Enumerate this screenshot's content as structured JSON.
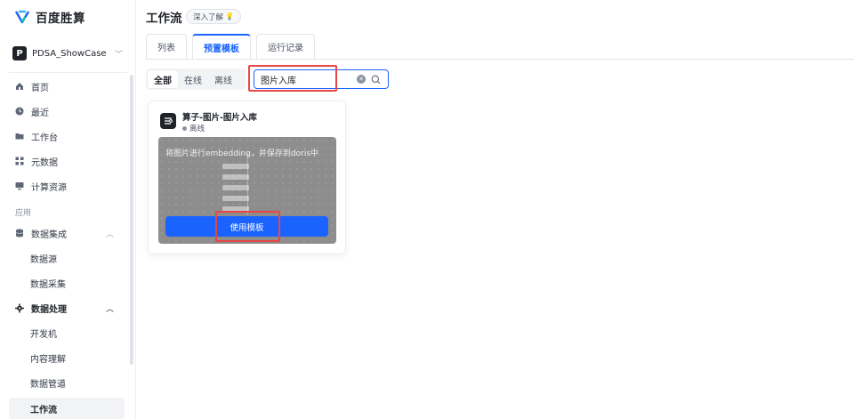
{
  "app": {
    "name": "百度胜算"
  },
  "workspace": {
    "avatar_letter": "P",
    "name": "PDSA_ShowCase"
  },
  "sidebar": {
    "items": [
      {
        "label": "首页",
        "icon": "home-icon"
      },
      {
        "label": "最近",
        "icon": "clock-icon"
      },
      {
        "label": "工作台",
        "icon": "folder-icon"
      },
      {
        "label": "元数据",
        "icon": "grid-icon"
      },
      {
        "label": "计算资源",
        "icon": "monitor-icon"
      }
    ],
    "section_label": "应用",
    "groups": [
      {
        "label": "数据集成",
        "icon": "database-icon",
        "children": [
          "数据源",
          "数据采集"
        ]
      },
      {
        "label": "数据处理",
        "icon": "gear-icon",
        "children": [
          "开发机",
          "内容理解",
          "数据管道",
          "工作流"
        ]
      }
    ]
  },
  "header": {
    "title": "工作流",
    "learn_more": "深入了解"
  },
  "tabs": [
    {
      "label": "列表"
    },
    {
      "label": "预置模板",
      "active": true
    },
    {
      "label": "运行记录"
    }
  ],
  "filters": [
    {
      "label": "全部",
      "active": true
    },
    {
      "label": "在线"
    },
    {
      "label": "离线"
    }
  ],
  "search": {
    "value": "图片入库"
  },
  "template_card": {
    "title": "算子-图片-图片入库",
    "status": "离线",
    "description": "将图片进行embedding，并保存到doris中",
    "button_label": "使用模板"
  },
  "colors": {
    "accent": "#1a63ff",
    "highlight_box": "#e84747",
    "status_offline": "#8a919f"
  }
}
